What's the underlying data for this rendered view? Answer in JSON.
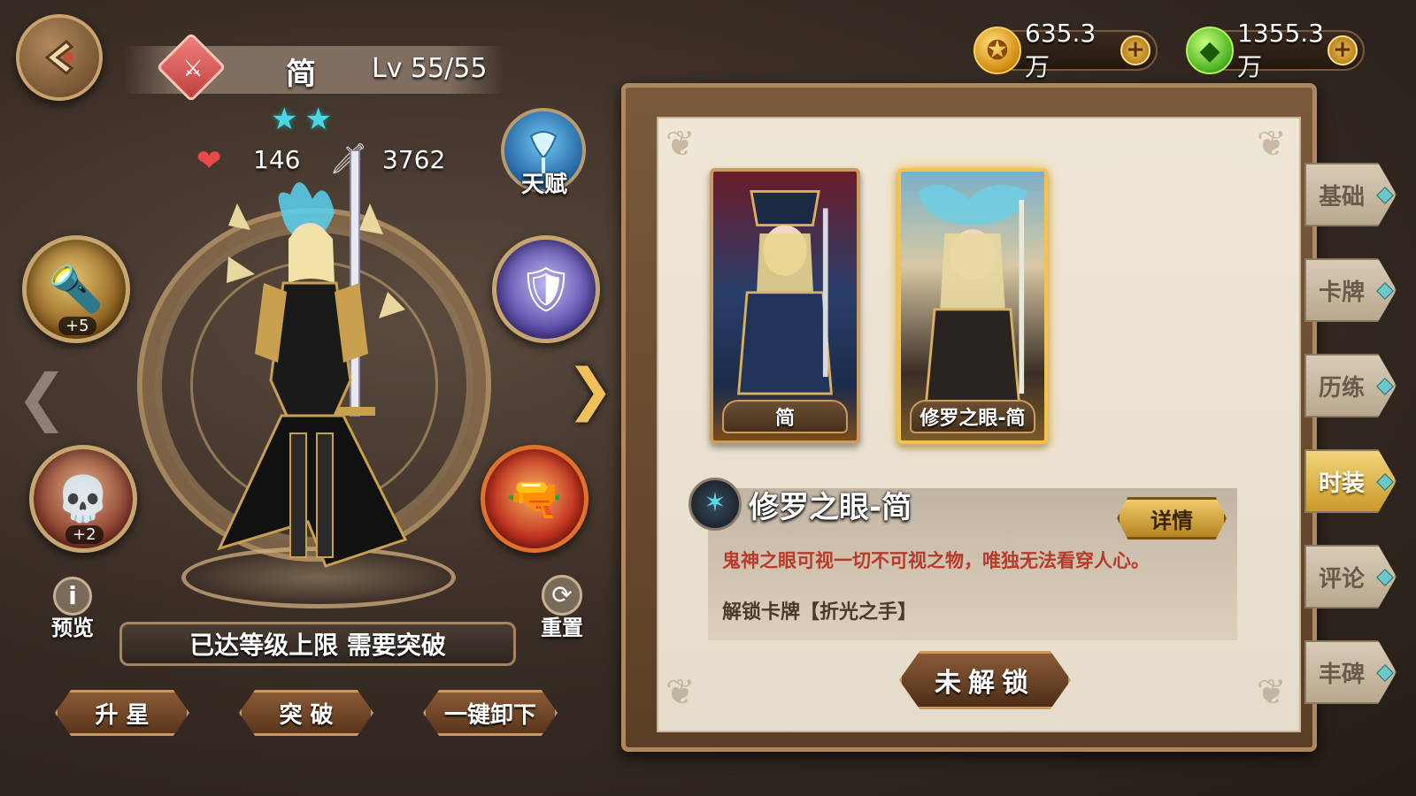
{
  "hero": {
    "name": "简",
    "level": "Lv 55/55",
    "stars": "★★",
    "hp": "146",
    "attack": "3762",
    "level_cap_text": "已达等级上限 需要突破"
  },
  "equipment": {
    "weapon_badge": "+5",
    "accessory_badge": "+2"
  },
  "buttons": {
    "talent": "天赋",
    "preview": "预览",
    "reset": "重置",
    "star_up": "升 星",
    "breakthrough": "突 破",
    "unequip_all": "一键卸下"
  },
  "currency": {
    "gold": "635.3万",
    "gems": "1355.3万"
  },
  "skins": [
    {
      "label": "简"
    },
    {
      "label": "修罗之眼-简"
    }
  ],
  "selected_skin": {
    "title": "修罗之眼-简",
    "detail_label": "详情",
    "description": "鬼神之眼可视一切不可视之物，唯独无法看穿人心。",
    "unlock_text": "解锁卡牌【折光之手】",
    "status_button": "未解锁"
  },
  "tabs": [
    {
      "label": "基础"
    },
    {
      "label": "卡牌"
    },
    {
      "label": "历练"
    },
    {
      "label": "时装",
      "active": true
    },
    {
      "label": "评论"
    },
    {
      "label": "丰碑"
    }
  ],
  "icons": {
    "back": "back-arrow-icon",
    "class": "sword-class-icon",
    "hp": "heart-icon",
    "attack": "sword-icon",
    "gold": "gold-coin-icon",
    "gems": "green-gem-icon"
  },
  "colors": {
    "accent_gold": "#f6c24a",
    "star": "#4fd6e6",
    "description_red": "#b83a2a"
  }
}
